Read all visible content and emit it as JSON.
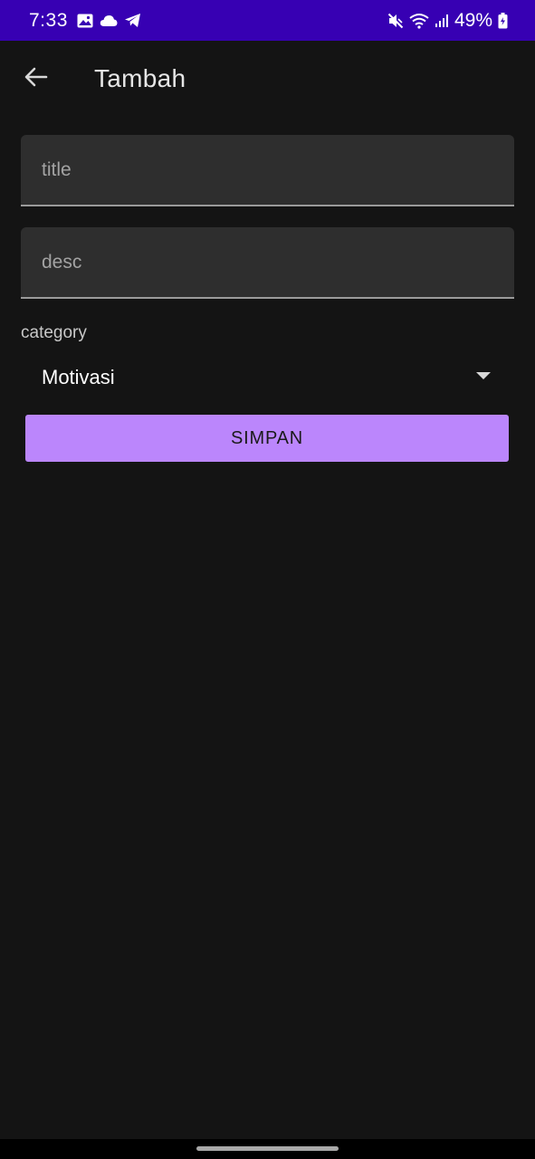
{
  "status_bar": {
    "time": "7:33",
    "battery": "49%",
    "left_icons": [
      "gallery-icon",
      "cloud-icon",
      "telegram-icon"
    ],
    "right_icons": [
      "mute-icon",
      "wifi-icon",
      "signal-icon",
      "battery-icon"
    ],
    "background": "#3700b3"
  },
  "app_bar": {
    "title": "Tambah",
    "back_icon": "arrow-back-icon"
  },
  "form": {
    "title_field": {
      "placeholder": "title",
      "value": ""
    },
    "desc_field": {
      "placeholder": "desc",
      "value": ""
    },
    "category_label": "category",
    "category_selected": "Motivasi",
    "save_label": "SIMPAN"
  },
  "colors": {
    "background": "#141414",
    "field_background": "#2e2e2e",
    "accent": "#bb86fc"
  }
}
